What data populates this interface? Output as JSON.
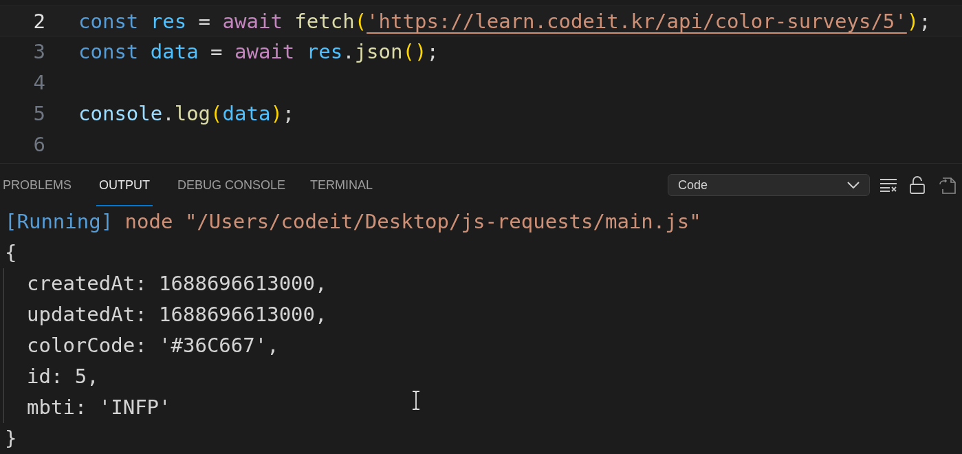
{
  "editor": {
    "lines": [
      {
        "number": "2",
        "current": true,
        "tokens": [
          {
            "kind": "keyword",
            "text": "const "
          },
          {
            "kind": "variable",
            "text": "res"
          },
          {
            "kind": "plain",
            "text": " = "
          },
          {
            "kind": "control",
            "text": "await "
          },
          {
            "kind": "function",
            "text": "fetch"
          },
          {
            "kind": "bracket",
            "text": "("
          },
          {
            "kind": "link",
            "text": "'https://learn.codeit.kr/api/color-surveys/5'"
          },
          {
            "kind": "bracket",
            "text": ")"
          },
          {
            "kind": "plain",
            "text": ";"
          }
        ]
      },
      {
        "number": "3",
        "current": false,
        "tokens": [
          {
            "kind": "keyword",
            "text": "const "
          },
          {
            "kind": "variable",
            "text": "data"
          },
          {
            "kind": "plain",
            "text": " = "
          },
          {
            "kind": "control",
            "text": "await "
          },
          {
            "kind": "variable",
            "text": "res"
          },
          {
            "kind": "plain",
            "text": "."
          },
          {
            "kind": "function",
            "text": "json"
          },
          {
            "kind": "bracket",
            "text": "()"
          },
          {
            "kind": "plain",
            "text": ";"
          }
        ]
      },
      {
        "number": "4",
        "current": false
      },
      {
        "number": "5",
        "current": false,
        "tokens": [
          {
            "kind": "object",
            "text": "console"
          },
          {
            "kind": "plain",
            "text": "."
          },
          {
            "kind": "function",
            "text": "log"
          },
          {
            "kind": "bracket",
            "text": "("
          },
          {
            "kind": "variable",
            "text": "data"
          },
          {
            "kind": "bracket",
            "text": ")"
          },
          {
            "kind": "plain",
            "text": ";"
          }
        ]
      },
      {
        "number": "6",
        "current": false
      }
    ]
  },
  "panel": {
    "tabs": [
      {
        "label": "PROBLEMS",
        "selected": false
      },
      {
        "label": "OUTPUT",
        "selected": true
      },
      {
        "label": "DEBUG CONSOLE",
        "selected": false
      },
      {
        "label": "TERMINAL",
        "selected": false
      }
    ],
    "channel_select": {
      "value": "Code"
    },
    "output": {
      "run_line": [
        {
          "kind": "status",
          "text": "[Running]"
        },
        {
          "kind": "command",
          "text": " node \"/Users/codeit/Desktop/js-requests/main.js\""
        }
      ],
      "open_brace": "{",
      "properties": [
        "createdAt: 1688696613000,",
        "updatedAt: 1688696613000,",
        "colorCode: '#36C667',",
        "id: 5,",
        "mbti: 'INFP'"
      ],
      "close_brace": "}"
    }
  }
}
